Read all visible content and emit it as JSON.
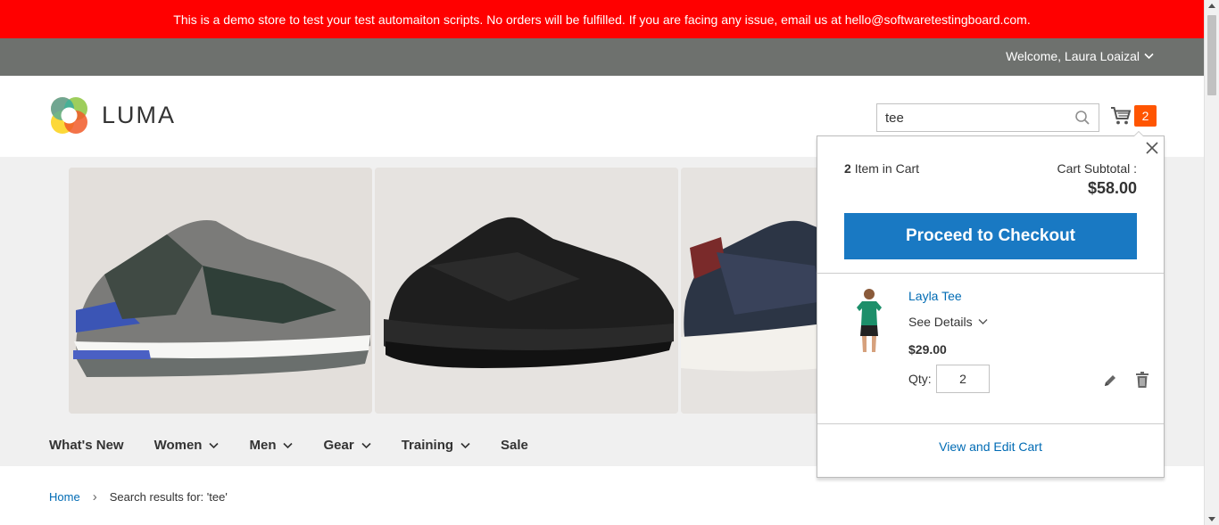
{
  "notice": {
    "text": "This is a demo store to test your test automaiton scripts. No orders will be fulfilled. If you are facing any issue, email us at hello@softwaretestingboard.com."
  },
  "topbar": {
    "welcome": "Welcome, Laura Loaizal"
  },
  "header": {
    "logo_text": "LUMA",
    "search": {
      "value": "tee"
    },
    "cart_count": "2"
  },
  "nav": {
    "items": [
      "What's New",
      "Women",
      "Men",
      "Gear",
      "Training",
      "Sale"
    ]
  },
  "breadcrumb": {
    "home": "Home",
    "separator": "›",
    "current": "Search results for: 'tee'"
  },
  "minicart": {
    "item_count": "2",
    "item_count_label": "Item in Cart",
    "subtotal_label": "Cart Subtotal :",
    "subtotal": "$58.00",
    "checkout_label": "Proceed to Checkout",
    "item": {
      "name": "Layla Tee",
      "details_label": "See Details",
      "price": "$29.00",
      "qty_label": "Qty:",
      "qty": "2"
    },
    "view_cart_label": "View and Edit Cart"
  },
  "colors": {
    "notice_bg": "#ff0000",
    "topbar_bg": "#6e716e",
    "link": "#006bb4",
    "primary_button": "#1979c3",
    "cart_badge": "#ff5501"
  }
}
